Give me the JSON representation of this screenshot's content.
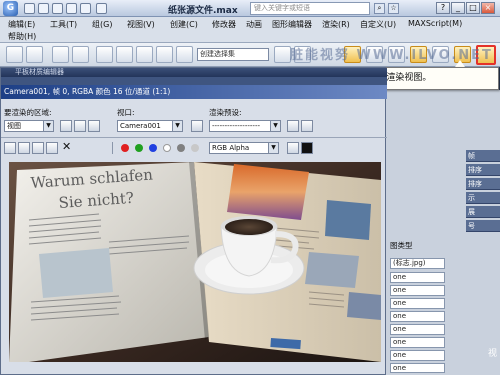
{
  "app": {
    "logo_glyph": "G",
    "title": "纸张源文件.max",
    "search_placeholder": "键入关键字或短语",
    "win_buttons": [
      "?",
      "_",
      "□",
      "×"
    ]
  },
  "menu": {
    "row1": [
      "编辑(E)",
      "工具(T)",
      "组(G)",
      "视图(V)",
      "创建(C)",
      "修改器",
      "动画",
      "图形编辑器",
      "渲染(R)",
      "自定义(U)",
      "MAXScript(M)"
    ],
    "row2": [
      "帮助(H)"
    ]
  },
  "toolbar": {
    "selection_set_placeholder": "创建选择集",
    "ref_coord": "视图",
    "watermark": "脏能视努   WWW.ILVO.NET"
  },
  "callout": {
    "text": "单击“渲染产品”按钮，渲染视图。"
  },
  "render_frame": {
    "top_title": "平板材质编辑器",
    "title": "Camera001, 帧 0, RGBA 颜色 16 位/通道 (1:1)",
    "area_label": "要渲染的区域:",
    "area_value": "视图",
    "viewport_label": "视口:",
    "viewport_value": "Camera001",
    "preset_label": "渲染预设:",
    "preset_value": "-------------------",
    "channel_value": "RGB Alpha",
    "channel_colors": [
      "#e02020",
      "#20a020",
      "#2040e0",
      "#ffffff",
      "#808080",
      "#c8c8c8"
    ]
  },
  "command_panel": {
    "side_tabs": [
      "帧",
      "排序",
      "排序",
      "示",
      "展",
      "号"
    ],
    "rows": [
      "图类型",
      "(标志.jpg)",
      "one",
      "one",
      "one",
      "one",
      "one",
      "one",
      "one",
      "one",
      "one"
    ],
    "caption": "视"
  },
  "image": {
    "magazine_heading_line1": "Warum schlafen",
    "magazine_heading_line2": "Sie nicht?"
  }
}
